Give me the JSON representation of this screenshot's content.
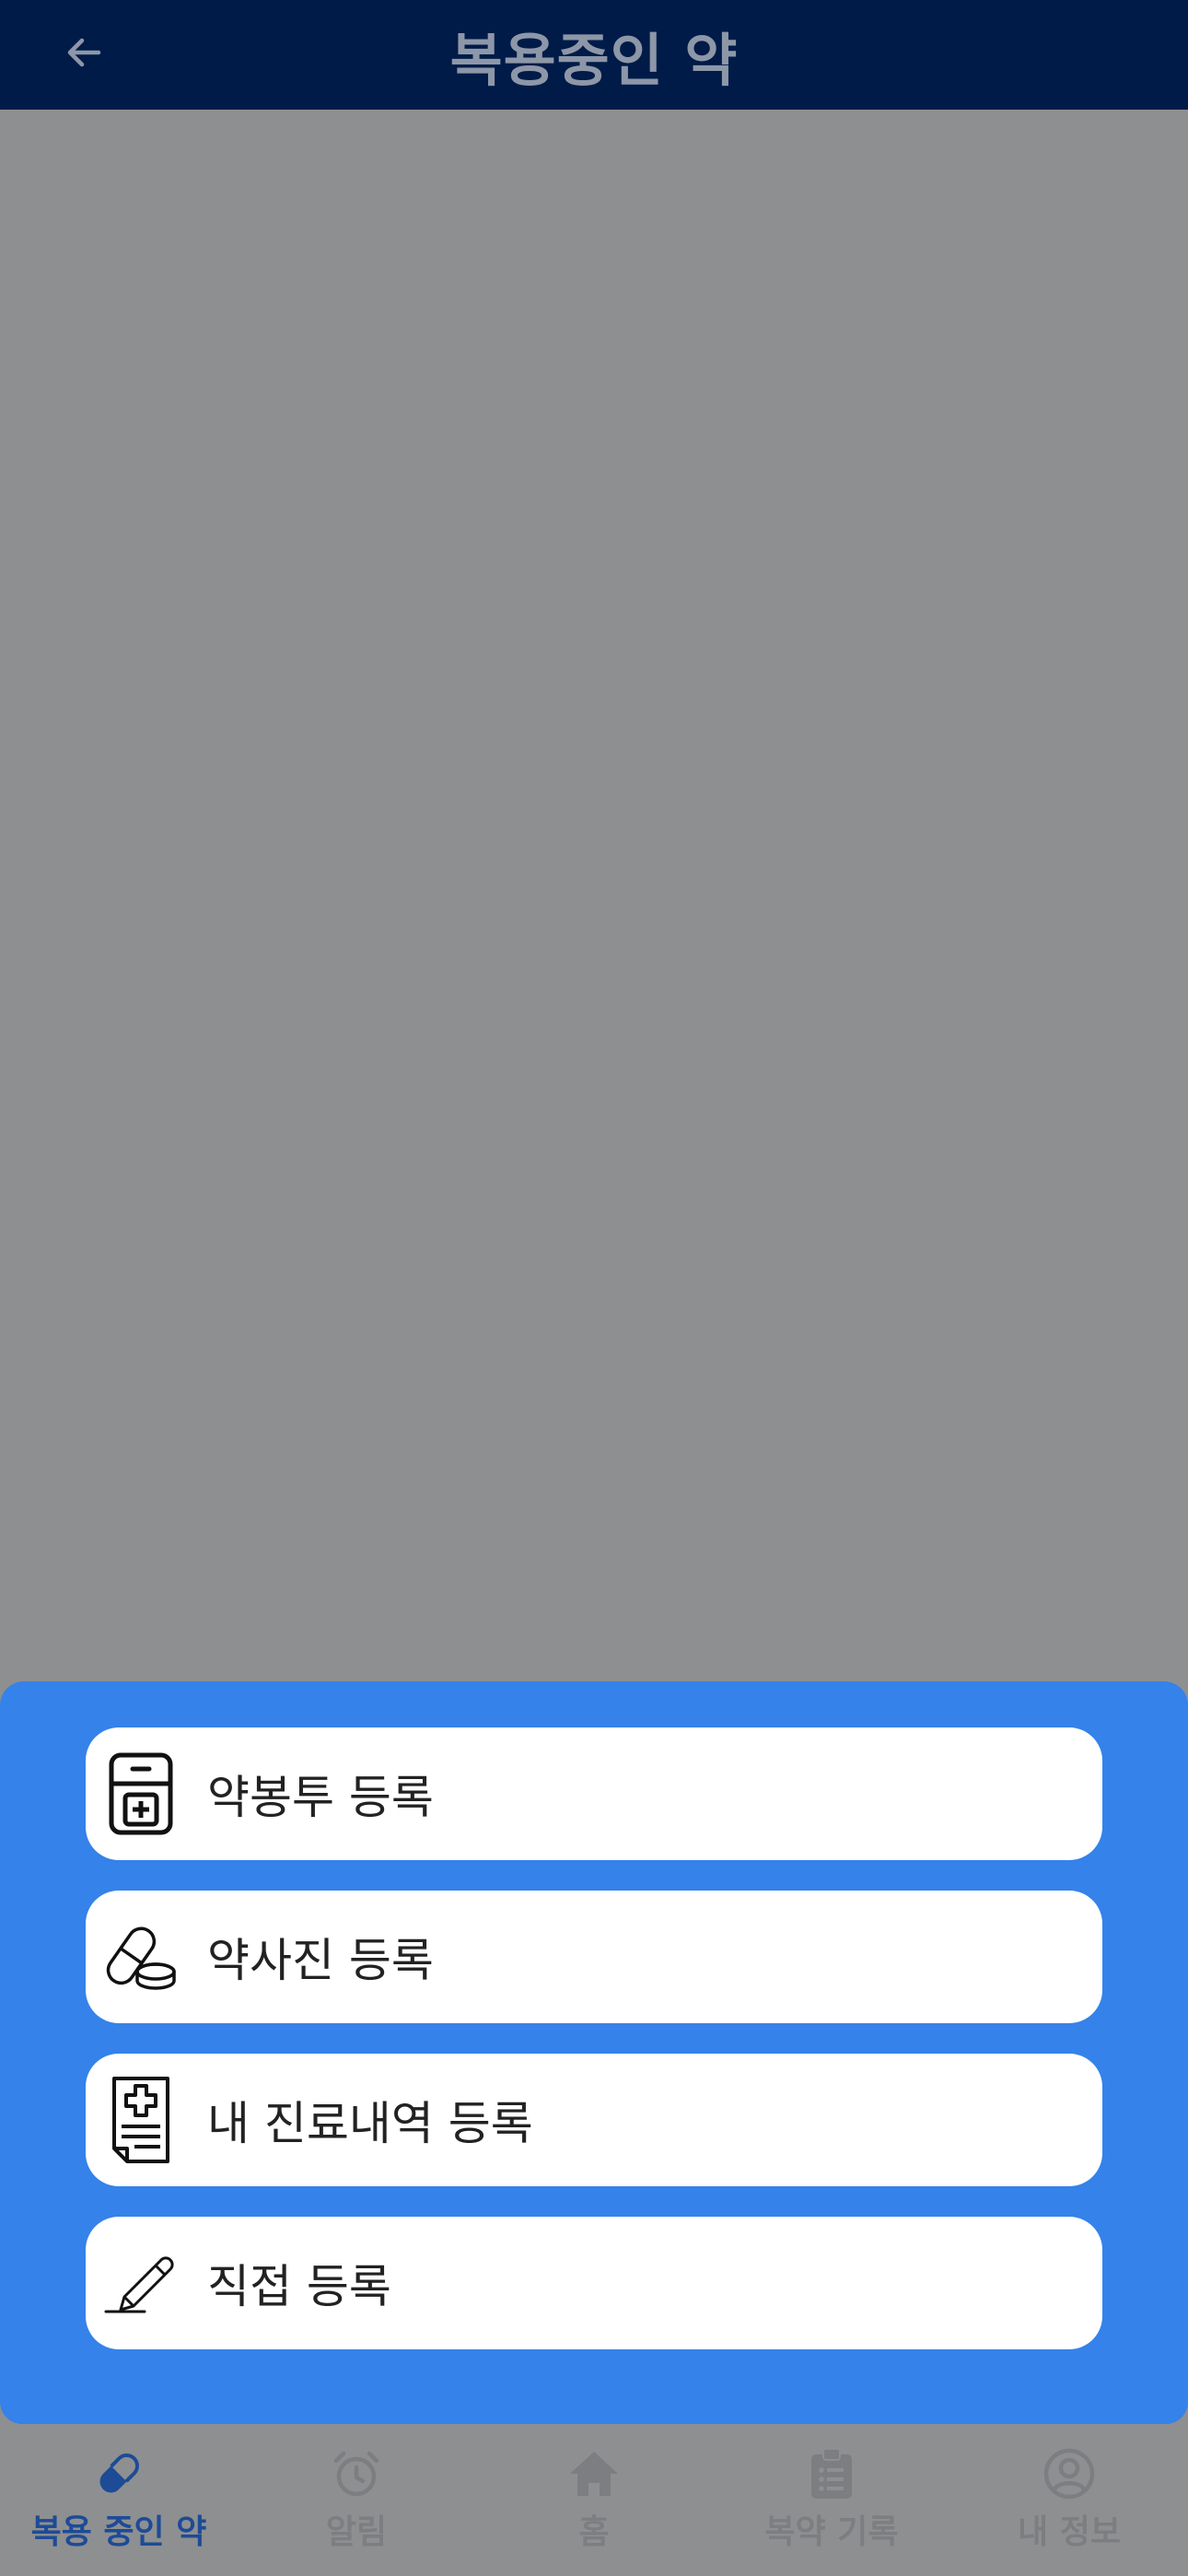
{
  "header": {
    "title": "복용중인 약",
    "back_icon": "arrow-left-icon"
  },
  "sheet": {
    "options": [
      {
        "label": "약봉투 등록",
        "icon": "medicine-envelope-icon"
      },
      {
        "label": "약사진 등록",
        "icon": "pill-capsule-icon"
      },
      {
        "label": "내 진료내역 등록",
        "icon": "medical-record-icon"
      },
      {
        "label": "직접 등록",
        "icon": "pencil-icon"
      }
    ]
  },
  "tabbar": {
    "tabs": [
      {
        "label": "복용 중인 약",
        "icon": "pill-icon",
        "active": true
      },
      {
        "label": "알림",
        "icon": "alarm-clock-icon",
        "active": false
      },
      {
        "label": "홈",
        "icon": "home-icon",
        "active": false
      },
      {
        "label": "복약 기록",
        "icon": "clipboard-icon",
        "active": false
      },
      {
        "label": "내 정보",
        "icon": "user-circle-icon",
        "active": false
      }
    ]
  },
  "colors": {
    "header_bg": "#001b48",
    "overlay": "#8e8f91",
    "sheet_bg": "#3482ea",
    "active_tab": "#1d4b96",
    "inactive_tab": "#7c7e81"
  }
}
